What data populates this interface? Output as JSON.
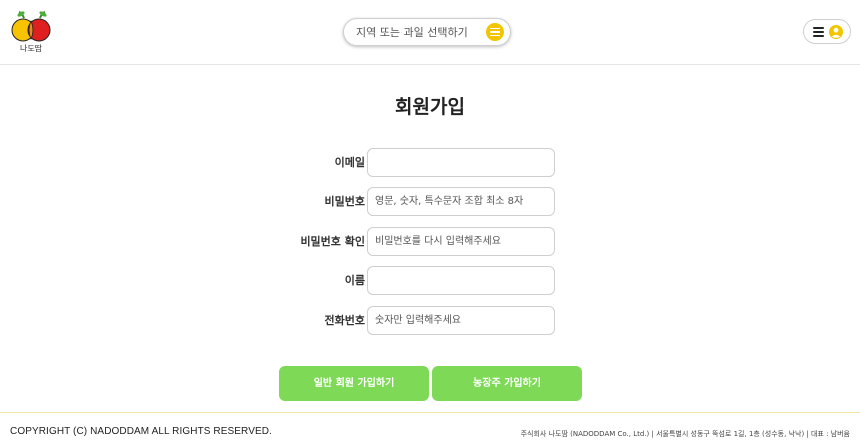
{
  "header": {
    "logo_text": "나도땀",
    "search_placeholder": "지역 또는 과일 선택하기"
  },
  "page": {
    "title": "회원가입"
  },
  "form": {
    "email_label": "이메일",
    "email_value": "",
    "password_label": "비밀번호",
    "password_placeholder": "영문, 숫자, 특수문자 조합 최소 8자",
    "password_confirm_label": "비밀번호 확인",
    "password_confirm_placeholder": "비밀번호를 다시 입력해주세요",
    "name_label": "이름",
    "name_value": "",
    "phone_label": "전화번호",
    "phone_placeholder": "숫자만 입력해주세요"
  },
  "buttons": {
    "general_signup": "일반 회원 가입하기",
    "farmer_signup": "농장주 가입하기"
  },
  "footer": {
    "copyright": "COPYRIGHT (C) NADODDAM ALL RIGHTS RESERVED.",
    "company_info": "주식회사 나도땀 (NADODDAM Co., Ltd.) | 서울특별시 성동구 뚝섬로 1길, 1층 (성수동, 낙낙) | 대표 : 남버윰"
  },
  "colors": {
    "accent_green": "#7ed957",
    "accent_yellow": "#f2c500",
    "logo_red": "#e02020"
  }
}
